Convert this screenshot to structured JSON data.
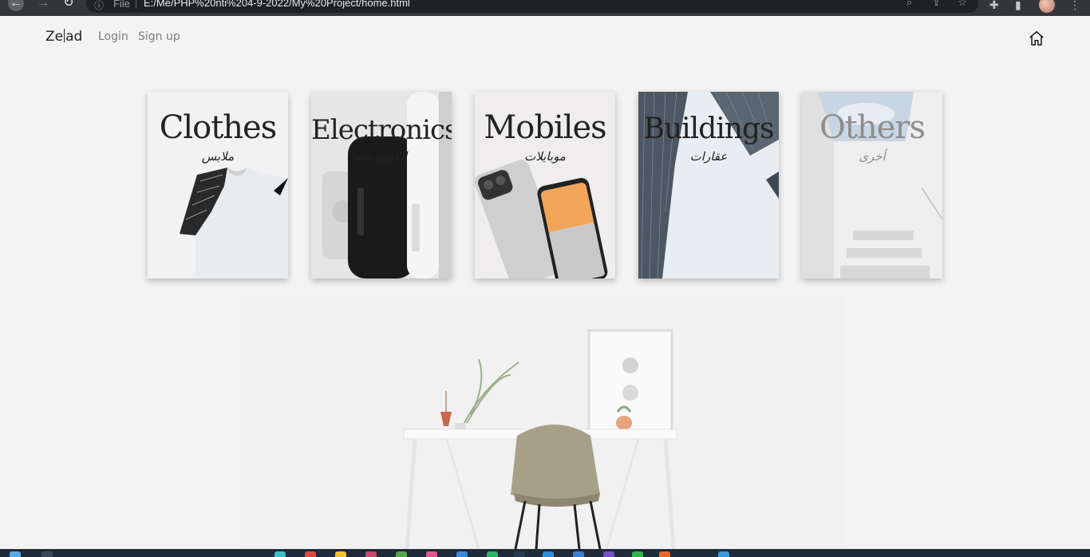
{
  "browser": {
    "protocol_label": "File",
    "url": "E:/Me/PHP%20nti%204-9-2022/My%20Project/home.html"
  },
  "header": {
    "brand": {
      "part1": "Ze",
      "part2": "ad"
    },
    "nav": [
      {
        "label": "Login"
      },
      {
        "label": "Sign up"
      }
    ],
    "home_icon": "home-icon"
  },
  "categories": [
    {
      "title": "Clothes",
      "subtitle": "ملابس",
      "image": "t-shirt"
    },
    {
      "title": "Electronics",
      "subtitle": "إلكترونيات",
      "image": "speaker"
    },
    {
      "title": "Mobiles",
      "subtitle": "موبايلات",
      "image": "phones"
    },
    {
      "title": "Buildings",
      "subtitle": "عقارات",
      "image": "skyscrapers"
    },
    {
      "title": "Others",
      "subtitle": "أخرى",
      "image": "staircase"
    }
  ],
  "colors": {
    "background": "#f3f3f3",
    "text": "#222222",
    "nav_text": "#7a7a7a",
    "chrome": "#35363a",
    "taskbar": "#1f2a3a"
  }
}
